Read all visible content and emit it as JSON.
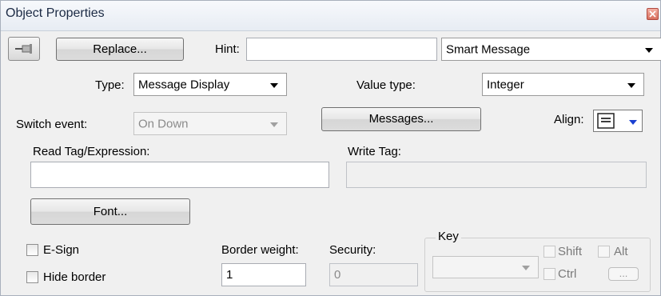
{
  "window": {
    "title": "Object Properties"
  },
  "toolbar": {
    "replace_label": "Replace...",
    "hint_label": "Hint:",
    "hint_value": "",
    "object_type": "Smart Message"
  },
  "form": {
    "type_label": "Type:",
    "type_value": "Message Display",
    "value_type_label": "Value type:",
    "value_type_value": "Integer",
    "switch_event_label": "Switch event:",
    "switch_event_value": "On Down",
    "messages_label": "Messages...",
    "align_label": "Align:",
    "read_tag_label": "Read Tag/Expression:",
    "read_tag_value": "",
    "write_tag_label": "Write Tag:",
    "write_tag_value": "",
    "font_label": "Font...",
    "esign_label": "E-Sign",
    "hide_border_label": "Hide border",
    "border_weight_label": "Border weight:",
    "border_weight_value": "1",
    "security_label": "Security:",
    "security_value": "0"
  },
  "key_group": {
    "label": "Key",
    "key_value": "",
    "shift_label": "Shift",
    "alt_label": "Alt",
    "ctrl_label": "Ctrl",
    "ellipsis_label": "..."
  }
}
